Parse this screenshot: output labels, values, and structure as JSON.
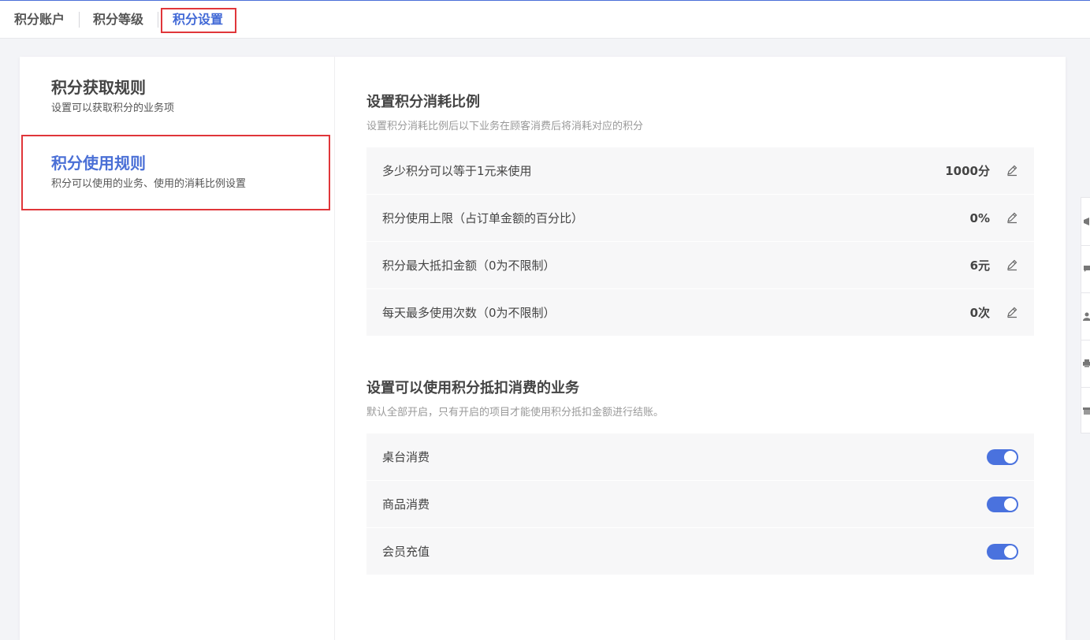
{
  "tabs": [
    {
      "label": "积分账户"
    },
    {
      "label": "积分等级"
    },
    {
      "label": "积分设置"
    }
  ],
  "sidebar": {
    "items": [
      {
        "title": "积分获取规则",
        "desc": "设置可以获取积分的业务项"
      },
      {
        "title": "积分使用规则",
        "desc": "积分可以使用的业务、使用的消耗比例设置"
      }
    ]
  },
  "ratio_section": {
    "title": "设置积分消耗比例",
    "desc": "设置积分消耗比例后以下业务在顾客消费后将消耗对应的积分",
    "rows": [
      {
        "label": "多少积分可以等于1元来使用",
        "value": "1000分"
      },
      {
        "label": "积分使用上限（占订单金额的百分比）",
        "value": "0%"
      },
      {
        "label": "积分最大抵扣金额（0为不限制）",
        "value": "6元"
      },
      {
        "label": "每天最多使用次数（0为不限制）",
        "value": "0次"
      }
    ]
  },
  "business_section": {
    "title": "设置可以使用积分抵扣消费的业务",
    "desc": "默认全部开启，只有开启的项目才能使用积分抵扣金额进行结账。",
    "rows": [
      {
        "label": "桌台消费",
        "enabled": true
      },
      {
        "label": "商品消费",
        "enabled": true
      },
      {
        "label": "会员充值",
        "enabled": true
      }
    ]
  },
  "colors": {
    "accent": "#4a6fd6",
    "highlight_border": "#e0363a",
    "toggle_on": "#4a72de"
  }
}
